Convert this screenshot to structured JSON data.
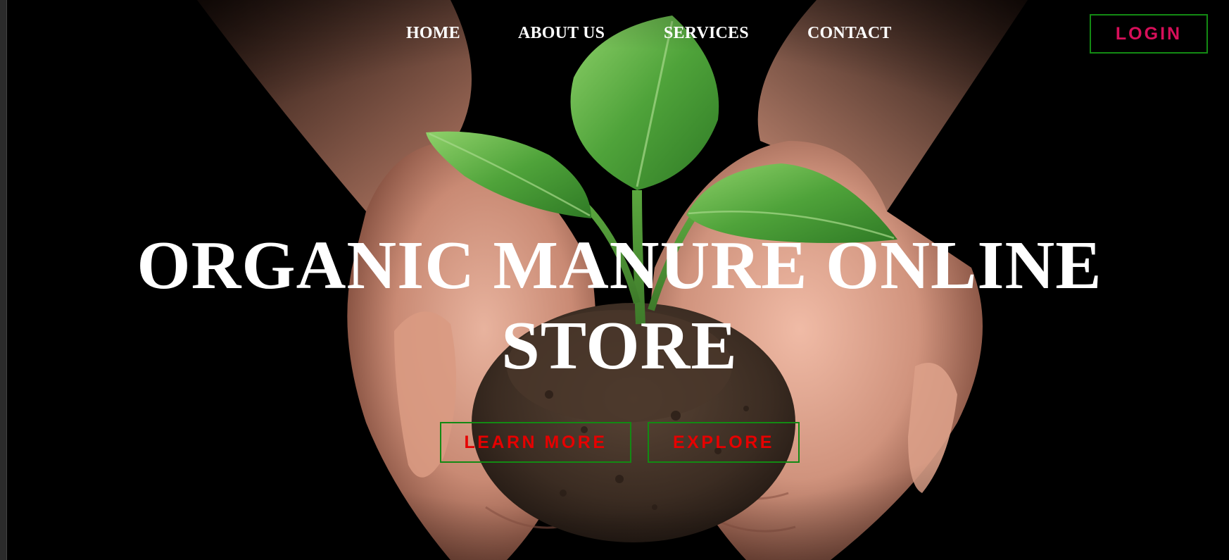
{
  "nav": {
    "items": [
      {
        "label": "HOME"
      },
      {
        "label": "ABOUT US"
      },
      {
        "label": "SERVICES"
      },
      {
        "label": "CONTACT"
      }
    ],
    "login_label": "LOGIN"
  },
  "hero": {
    "title": "ORGANIC MANURE ONLINE STORE",
    "buttons": {
      "learn_more": "LEARN MORE",
      "explore": "EXPLORE"
    },
    "background": "hands-holding-seedling-in-soil"
  },
  "colors": {
    "background": "#000000",
    "nav_text": "#ffffff",
    "button_border": "#138a13",
    "login_text": "#d80f5a",
    "cta_text": "#e60000"
  }
}
